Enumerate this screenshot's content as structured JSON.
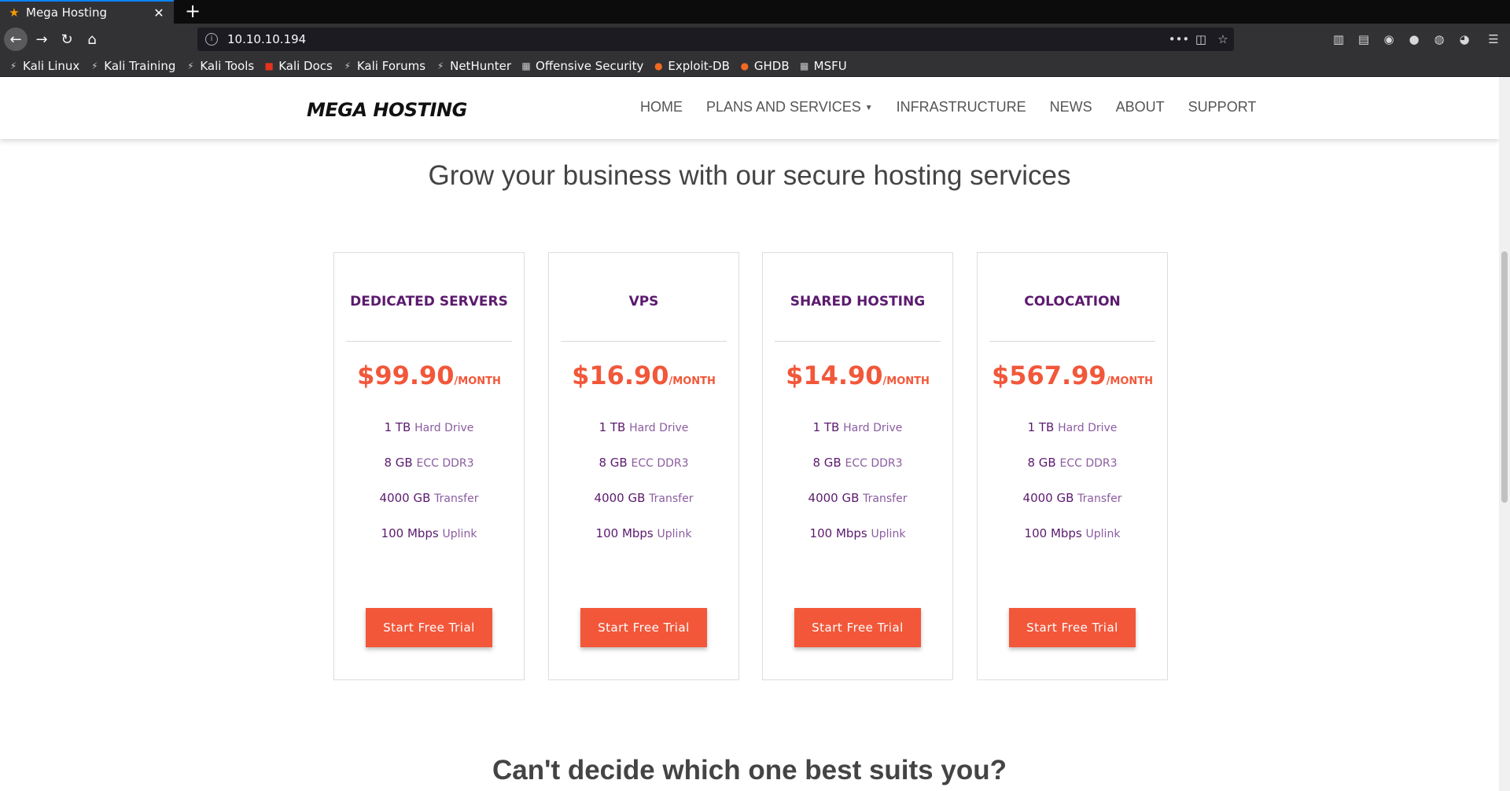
{
  "browser": {
    "tab_title": "Mega Hosting",
    "url": "10.10.10.194",
    "bookmarks": [
      "Kali Linux",
      "Kali Training",
      "Kali Tools",
      "Kali Docs",
      "Kali Forums",
      "NetHunter",
      "Offensive Security",
      "Exploit-DB",
      "GHDB",
      "MSFU"
    ]
  },
  "site": {
    "brand": "MEGA HOSTING",
    "nav": [
      "HOME",
      "PLANS AND SERVICES",
      "INFRASTRUCTURE",
      "NEWS",
      "ABOUT",
      "SUPPORT"
    ],
    "headline": "Grow your business with our secure hosting services",
    "headline2": "Can't decide which one best suits you?"
  },
  "plans": [
    {
      "name": "DEDICATED SERVERS",
      "price": "$99.90",
      "unit": "/MONTH"
    },
    {
      "name": "VPS",
      "price": "$16.90",
      "unit": "/MONTH"
    },
    {
      "name": "SHARED HOSTING",
      "price": "$14.90",
      "unit": "/MONTH"
    },
    {
      "name": "COLOCATION",
      "price": "$567.99",
      "unit": "/MONTH"
    }
  ],
  "features": [
    {
      "value": "1 TB",
      "label": "Hard Drive"
    },
    {
      "value": "8 GB",
      "label": "ECC DDR3"
    },
    {
      "value": "4000 GB",
      "label": "Transfer"
    },
    {
      "value": "100 Mbps",
      "label": "Uplink"
    }
  ],
  "cta_label": "Start Free Trial",
  "colors": {
    "accent": "#f2573a",
    "plan_title": "#5b1a6e",
    "firefox_dark": "#323234"
  }
}
